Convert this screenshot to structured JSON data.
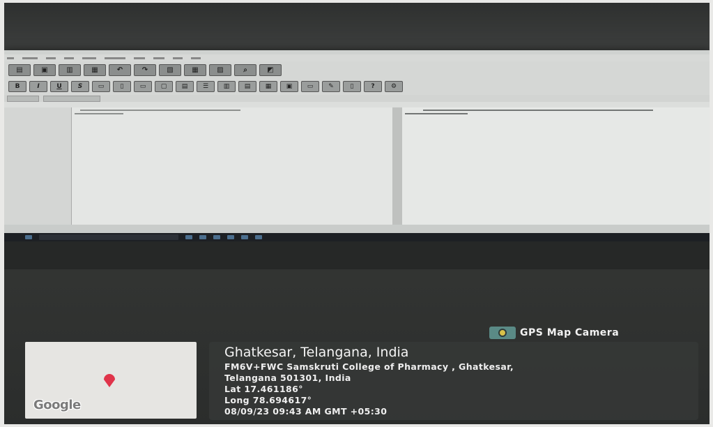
{
  "overlay": {
    "app_name": "GPS Map Camera",
    "location_title": "Ghatkesar, Telangana, India",
    "address_line1": "FM6V+FWC Samskruti College of Pharmacy , Ghatkesar,",
    "address_line2": "Telangana 501301, India",
    "latitude": "Lat 17.461186°",
    "longitude": "Long 78.694617°",
    "datetime": "08/09/23 09:43 AM GMT +05:30",
    "map_brand": "Google",
    "pin_color": "#e0344a"
  },
  "toolbar": {
    "row2_labels": [
      "B",
      "I",
      "U",
      "S"
    ]
  }
}
